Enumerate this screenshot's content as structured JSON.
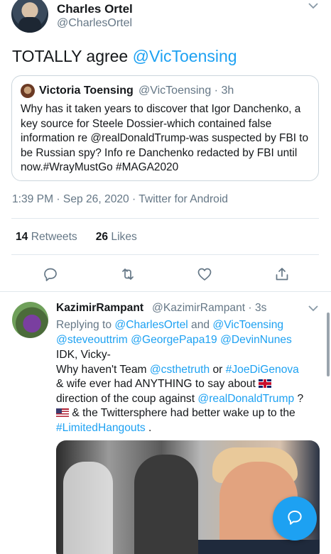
{
  "main_tweet": {
    "author_name": "Charles Ortel",
    "author_handle": "@CharlesOrtel",
    "text_plain": "TOTALLY agree ",
    "text_mention": "@VicToensing",
    "quote": {
      "author_name": "Victoria Toensing",
      "author_handle_time": "@VicToensing · 3h",
      "text": "Why has it taken years to discover that Igor Danchenko, a key source for Steele Dossier-which contained false information re @realDonaldTrump-was suspected by FBI to be Russian spy? Info re Danchenko redacted by FBI until now.#WrayMustGo #MAGA2020"
    },
    "meta": "1:39 PM · Sep 26, 2020 · Twitter for Android",
    "retweets_count": "14",
    "retweets_label": "Retweets",
    "likes_count": "26",
    "likes_label": "Likes"
  },
  "reply": {
    "author_name": "KazimirRampant",
    "author_handle_time": "@KazimirRampant · 3s",
    "replying_prefix": "Replying to ",
    "replying_to_1": "@CharlesOrtel",
    "replying_and": " and ",
    "replying_to_2": "@VicToensing",
    "replying_to_3": "@steveouttrim",
    "replying_to_4": "@GeorgePapa19",
    "replying_to_5": "@DevinNunes",
    "line1": "IDK, Vicky-",
    "line2_a": "Why haven't Team ",
    "line2_link1": "@csthetruth",
    "line2_b": " or ",
    "line2_link2": "#JoeDiGenova",
    "line3": "& wife ever had ANYTHING to say about ",
    "line4_a": "direction of the coup against ",
    "line4_link": "@realDonaldTrump",
    "line4_b": " ?",
    "line5": " & the Twittersphere had better wake up to the",
    "line6_link": "#LimitedHangouts",
    "line6_b": " ."
  },
  "icons": [
    "chevron-down-icon",
    "reply-icon",
    "retweet-icon",
    "like-icon",
    "share-icon",
    "compose-reply-icon",
    "flag-uk-icon",
    "flag-us-icon"
  ],
  "colors": {
    "accent": "#1da1f2",
    "secondary_text": "#657786",
    "divider": "#e1e8ed"
  }
}
